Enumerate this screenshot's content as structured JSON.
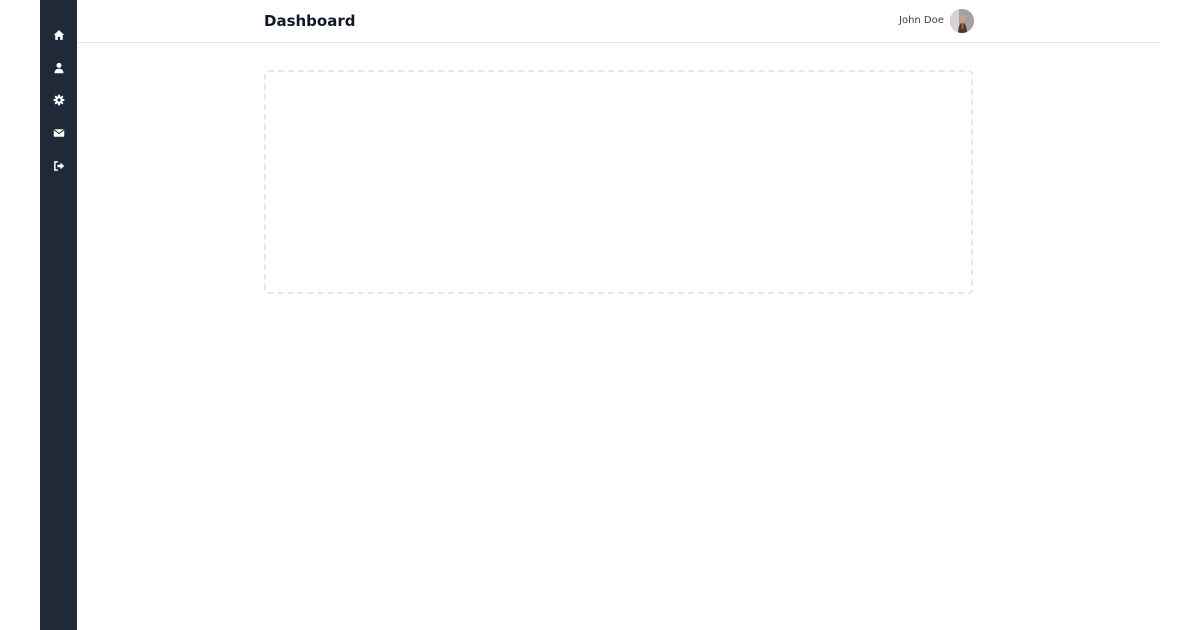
{
  "colors": {
    "sidebar_bg": "#1f2937",
    "icon": "#ffffff",
    "header_border": "#e5e7eb",
    "title_text": "#111827",
    "placeholder_border": "#e5e7eb"
  },
  "sidebar": {
    "items": [
      {
        "icon": "home-icon"
      },
      {
        "icon": "user-icon"
      },
      {
        "icon": "gear-icon"
      },
      {
        "icon": "envelope-icon"
      },
      {
        "icon": "sign-out-icon"
      }
    ]
  },
  "header": {
    "title": "Dashboard",
    "user_name": "John Doe",
    "avatar_icon": "avatar-photo"
  }
}
